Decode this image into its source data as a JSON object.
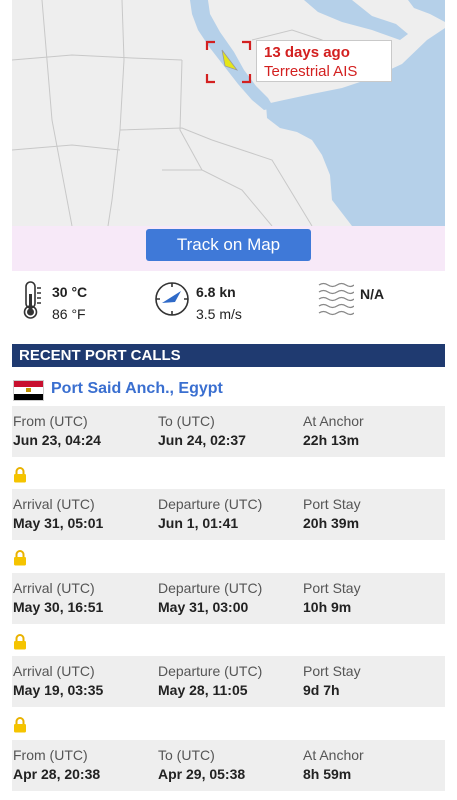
{
  "map": {
    "callout_time": "13 days ago",
    "callout_source": "Terrestrial AIS",
    "vessel_icon": "vessel-arrow-icon",
    "colors": {
      "land": "#eeeeee",
      "sea": "#b5d0e9",
      "border": "#c8c8c8",
      "marker": "#d32020",
      "vessel": "#e5e619"
    }
  },
  "track_button": {
    "label": "Track on Map"
  },
  "weather": {
    "temperature": {
      "celsius": "30 °C",
      "fahrenheit": "86 °F"
    },
    "wind": {
      "knots": "6.8 kn",
      "ms": "3.5 m/s"
    },
    "waves": {
      "value": "N/A"
    }
  },
  "section": {
    "title": "RECENT PORT CALLS"
  },
  "port": {
    "name": "Port Said Anch., Egypt",
    "flag": "egypt-flag-icon"
  },
  "calls": [
    {
      "c1_label": "From (UTC)",
      "c1_value": "Jun 23, 04:24",
      "c2_label": "To (UTC)",
      "c2_value": "Jun 24, 02:37",
      "c3_label": "At Anchor",
      "c3_value": "22h 13m"
    },
    {
      "c1_label": "Arrival (UTC)",
      "c1_value": "May 31, 05:01",
      "c2_label": "Departure (UTC)",
      "c2_value": "Jun 1, 01:41",
      "c3_label": "Port Stay",
      "c3_value": "20h 39m"
    },
    {
      "c1_label": "Arrival (UTC)",
      "c1_value": "May 30, 16:51",
      "c2_label": "Departure (UTC)",
      "c2_value": "May 31, 03:00",
      "c3_label": "Port Stay",
      "c3_value": "10h 9m"
    },
    {
      "c1_label": "Arrival (UTC)",
      "c1_value": "May 19, 03:35",
      "c2_label": "Departure (UTC)",
      "c2_value": "May 28, 11:05",
      "c3_label": "Port Stay",
      "c3_value": "9d 7h"
    },
    {
      "c1_label": "From (UTC)",
      "c1_value": "Apr 28, 20:38",
      "c2_label": "To (UTC)",
      "c2_value": "Apr 29, 05:38",
      "c3_label": "At Anchor",
      "c3_value": "8h 59m"
    }
  ],
  "lock_icon": "lock-icon"
}
